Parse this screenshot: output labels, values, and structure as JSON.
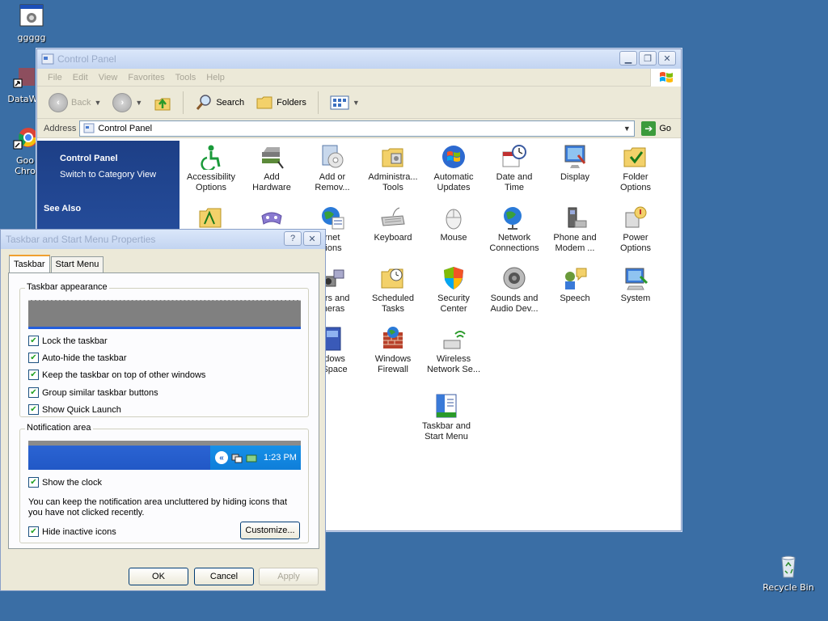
{
  "desktop": {
    "icons": [
      {
        "label": "ggggg",
        "icon": "app-window-icon"
      },
      {
        "label": "DataWa",
        "icon": "shortcut-icon"
      },
      {
        "label": "Goo",
        "label2": "Chro",
        "icon": "chrome-icon"
      },
      {
        "label": "Recycle Bin",
        "icon": "recycle-bin-icon"
      }
    ]
  },
  "control_panel": {
    "title": "Control Panel",
    "menu": [
      "File",
      "Edit",
      "View",
      "Favorites",
      "Tools",
      "Help"
    ],
    "toolbar": {
      "back": "Back",
      "search": "Search",
      "folders": "Folders"
    },
    "address_label": "Address",
    "address_value": "Control Panel",
    "go_label": "Go",
    "left_pane": {
      "section_title": "Control Panel",
      "switch_link": "Switch to Category View",
      "see_also": "See Also"
    },
    "items": [
      {
        "line1": "Accessibility",
        "line2": "Options"
      },
      {
        "line1": "Add",
        "line2": "Hardware"
      },
      {
        "line1": "Add or",
        "line2": "Remov..."
      },
      {
        "line1": "Administra...",
        "line2": "Tools"
      },
      {
        "line1": "Automatic",
        "line2": "Updates"
      },
      {
        "line1": "Date and",
        "line2": "Time"
      },
      {
        "line1": "Display",
        "line2": ""
      },
      {
        "line1": "Folder",
        "line2": "Options"
      },
      {
        "line1": "rnet",
        "line2": "tions"
      },
      {
        "line1": "Keyboard",
        "line2": ""
      },
      {
        "line1": "Mouse",
        "line2": ""
      },
      {
        "line1": "Network",
        "line2": "Connections"
      },
      {
        "line1": "Phone and",
        "line2": "Modem ..."
      },
      {
        "line1": "Power",
        "line2": "Options"
      },
      {
        "line1": "ners and",
        "line2": "meras"
      },
      {
        "line1": "Scheduled",
        "line2": "Tasks"
      },
      {
        "line1": "Security",
        "line2": "Center"
      },
      {
        "line1": "Sounds and",
        "line2": "Audio Dev..."
      },
      {
        "line1": "Speech",
        "line2": ""
      },
      {
        "line1": "System",
        "line2": ""
      },
      {
        "line1": "ndows",
        "line2": "dSpace"
      },
      {
        "line1": "Windows",
        "line2": "Firewall"
      },
      {
        "line1": "Wireless",
        "line2": "Network Se..."
      },
      {
        "line1": "Taskbar and",
        "line2": "Start Menu"
      }
    ]
  },
  "dialog": {
    "title": "Taskbar and Start Menu Properties",
    "help_btn": "?",
    "tabs": [
      "Taskbar",
      "Start Menu"
    ],
    "taskbar_appearance": {
      "label": "Taskbar appearance",
      "options": [
        {
          "label": "Lock the taskbar",
          "checked": true
        },
        {
          "label": "Auto-hide the taskbar",
          "checked": true
        },
        {
          "label": "Keep the taskbar on top of other windows",
          "checked": true
        },
        {
          "label": "Group similar taskbar buttons",
          "checked": true
        },
        {
          "label": "Show Quick Launch",
          "checked": true
        }
      ]
    },
    "notification_area": {
      "label": "Notification area",
      "clock": "1:23 PM",
      "show_clock": "Show the clock",
      "info": "You can keep the notification area uncluttered by hiding icons that you have not clicked recently.",
      "hide_inactive": "Hide inactive icons",
      "customize": "Customize..."
    },
    "buttons": {
      "ok": "OK",
      "cancel": "Cancel",
      "apply": "Apply"
    }
  }
}
